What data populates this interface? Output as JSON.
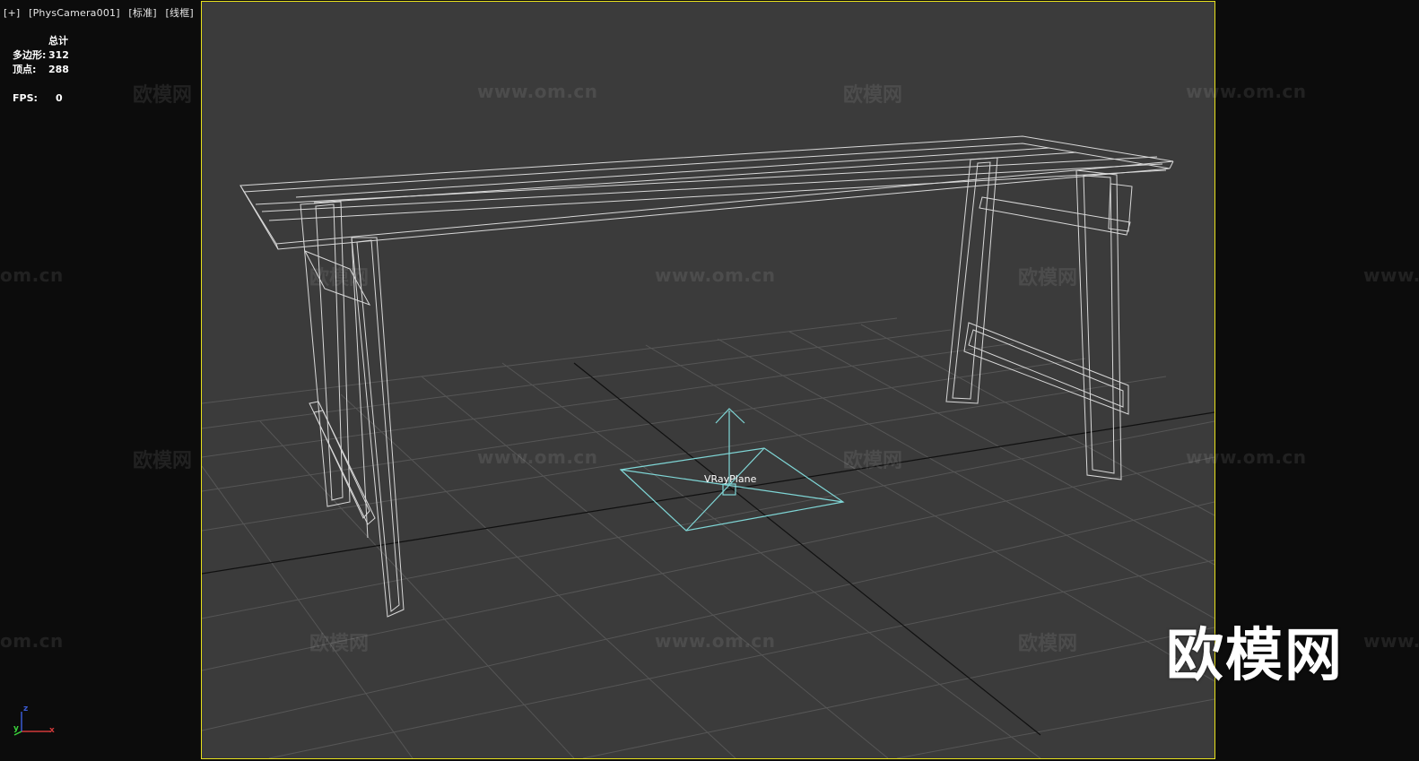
{
  "viewport": {
    "labels": [
      "[+]",
      "[PhysCamera001]",
      "[标准]",
      "[线框]"
    ]
  },
  "stats": {
    "title": "总计",
    "polygons_label": "多边形:",
    "polygons_value": "312",
    "vertices_label": "顶点:",
    "vertices_value": "288",
    "fps_label": "FPS:",
    "fps_value": "0"
  },
  "scene": {
    "object_label": "VRayPlane"
  },
  "axis_gizmo": {
    "x": "x",
    "y": "y",
    "z": "z"
  },
  "watermark": {
    "logo": "欧模网",
    "url": "www.om.cn",
    "url_short": "om.cn",
    "url_prefix": "www."
  },
  "colors": {
    "frame_border": "#e8e11c",
    "viewport_bg": "#3b3b3b",
    "gizmo": "#7fd6d6",
    "wire": "#e0e0e0"
  }
}
